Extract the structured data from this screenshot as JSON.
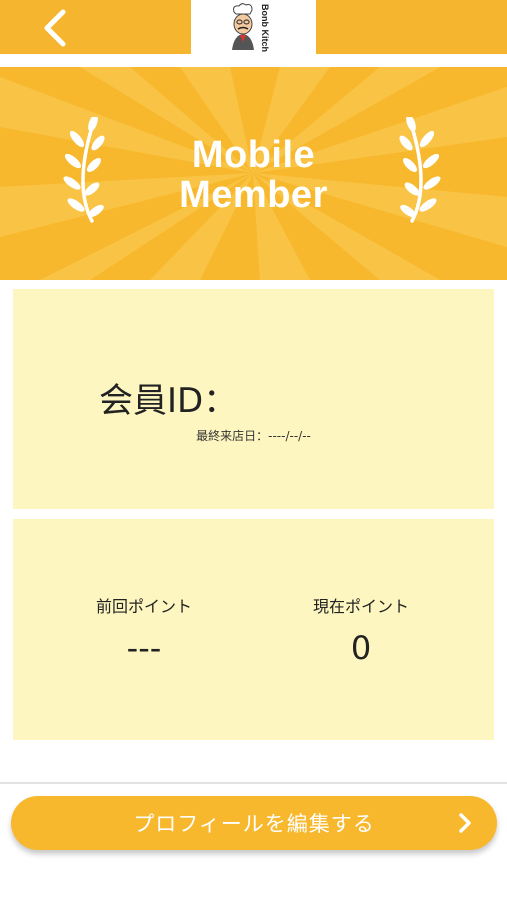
{
  "header": {
    "back_icon": "chevron-left-icon",
    "logo_text": "Bonb Kitchen",
    "bg_color": "#f6b52f"
  },
  "banner": {
    "title_line1": "Mobile",
    "title_line2": "Member",
    "left_icon": "laurel-branch-icon",
    "right_icon": "laurel-branch-icon"
  },
  "member": {
    "id_label": "会員ID：",
    "last_visit": "最終来店日：----/--/--"
  },
  "points": {
    "previous_label": "前回ポイント",
    "previous_value": "---",
    "current_label": "現在ポイント",
    "current_value": "0"
  },
  "profile_button": {
    "label": "プロフィールを編集する",
    "icon": "chevron-right-icon"
  },
  "colors": {
    "accent": "#f6b52f",
    "card": "#fef6c0",
    "text": "#222222"
  }
}
